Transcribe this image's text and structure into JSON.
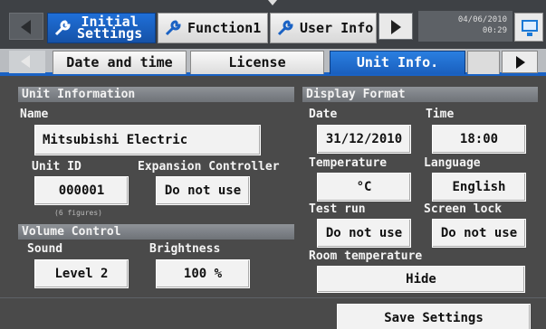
{
  "topnav": {
    "tabs": [
      {
        "label_line1": "Initial",
        "label_line2": "Settings",
        "active": true
      },
      {
        "label": "Function1",
        "active": false
      },
      {
        "label": "User Info",
        "active": false
      }
    ],
    "date": "04/06/2010",
    "time": "00:29"
  },
  "subtabs": [
    {
      "label": "Date and time",
      "active": false
    },
    {
      "label": "License",
      "active": false
    },
    {
      "label": "Unit Info.",
      "active": true
    }
  ],
  "unit_information": {
    "header": "Unit Information",
    "name_label": "Name",
    "name_value": "Mitsubishi Electric",
    "unit_id_label": "Unit ID",
    "unit_id_value": "000001",
    "unit_id_hint": "(6 figures)",
    "expansion_label": "Expansion Controller",
    "expansion_value": "Do not use"
  },
  "volume_control": {
    "header": "Volume Control",
    "sound_label": "Sound",
    "sound_value": "Level 2",
    "brightness_label": "Brightness",
    "brightness_value": "100 %"
  },
  "display_format": {
    "header": "Display Format",
    "date_label": "Date",
    "date_value": "31/12/2010",
    "time_label": "Time",
    "time_value": "18:00",
    "temperature_label": "Temperature",
    "temperature_value": "°C",
    "language_label": "Language",
    "language_value": "English",
    "test_run_label": "Test run",
    "test_run_value": "Do not use",
    "screen_lock_label": "Screen lock",
    "screen_lock_value": "Do not use",
    "room_temp_label": "Room temperature",
    "room_temp_value": "Hide"
  },
  "footer": {
    "save_label": "Save Settings"
  },
  "colors": {
    "accent": "#1a62c4",
    "background": "#4a4a4a"
  }
}
